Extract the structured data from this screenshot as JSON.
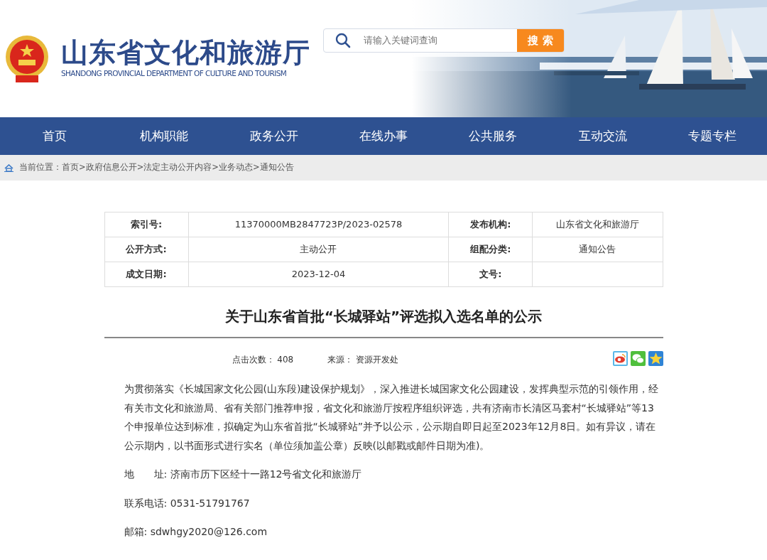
{
  "header": {
    "title": "山东省文化和旅游厅",
    "subtitle": "SHANDONG PROVINCIAL DEPARTMENT OF CULTURE AND TOURISM",
    "search": {
      "placeholder": "请输入关键词查询",
      "button": "搜 索"
    }
  },
  "nav": [
    {
      "label": "首页"
    },
    {
      "label": "机构职能"
    },
    {
      "label": "政务公开"
    },
    {
      "label": "在线办事"
    },
    {
      "label": "公共服务"
    },
    {
      "label": "互动交流"
    },
    {
      "label": "专题专栏"
    }
  ],
  "breadcrumb": {
    "label": "当前位置：",
    "separator": ">",
    "items": [
      "首页",
      "政府信息公开",
      "法定主动公开内容",
      "业务动态",
      "通知公告"
    ]
  },
  "info_table": [
    [
      {
        "label": "索引号:",
        "value": "11370000MB2847723P/2023-02578"
      },
      {
        "label": "发布机构:",
        "value": "山东省文化和旅游厅"
      }
    ],
    [
      {
        "label": "公开方式:",
        "value": "主动公开"
      },
      {
        "label": "组配分类:",
        "value": "通知公告"
      }
    ],
    [
      {
        "label": "成文日期:",
        "value": "2023-12-04"
      },
      {
        "label": "文号:"
      }
    ]
  ],
  "article": {
    "title": "关于山东省首批“长城驿站”评选拟入选名单的公示",
    "stats": [
      {
        "label": "点击次数：",
        "value": "408"
      },
      {
        "label": "来源：",
        "value": "资源开发处"
      }
    ],
    "paragraphs": [
      "为贯彻落实《长城国家文化公园(山东段)建设保护规划》，深入推进长城国家文化公园建设，发挥典型示范的引领作用，经有关市文化和旅游局、省有关部门推荐申报，省文化和旅游厅按程序组织评选，共有济南市长清区马套村“长城驿站”等13个申报单位达到标准，拟确定为山东省首批“长城驿站”并予以公示，公示期自即日起至2023年12月8日。如有异议，请在公示期内，以书面形式进行实名（单位须加盖公章）反映(以邮戳或邮件日期为准)。"
    ],
    "contacts": [
      "地　　址: 济南市历下区经十一路12号省文化和旅游厅",
      "联系电话: 0531-51791767",
      "邮箱: sdwhgy2020@126.com"
    ]
  }
}
